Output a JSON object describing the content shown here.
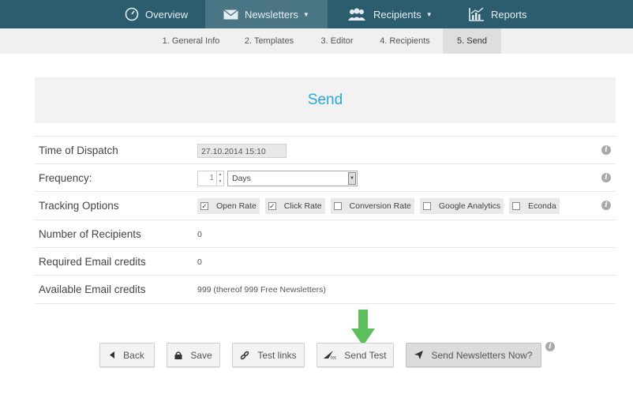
{
  "nav": {
    "overview": "Overview",
    "newsletters": "Newsletters",
    "recipients": "Recipients",
    "reports": "Reports"
  },
  "steps": [
    "1. General Info",
    "2. Templates",
    "3. Editor",
    "4. Recipients",
    "5. Send"
  ],
  "panel": {
    "title": "Send"
  },
  "rows": {
    "dispatch": {
      "label": "Time of Dispatch",
      "value": "27.10.2014 15:10"
    },
    "frequency": {
      "label": "Frequency:",
      "count": "1",
      "unit": "Days"
    },
    "tracking": {
      "label": "Tracking Options",
      "options": [
        {
          "label": "Open Rate",
          "checked": true
        },
        {
          "label": "Click Rate",
          "checked": true
        },
        {
          "label": "Conversion Rate",
          "checked": false
        },
        {
          "label": "Google Analytics",
          "checked": false
        },
        {
          "label": "Econda",
          "checked": false
        }
      ]
    },
    "num_recipients": {
      "label": "Number of Recipients",
      "value": "0"
    },
    "required_credits": {
      "label": "Required Email credits",
      "value": "0"
    },
    "available_credits": {
      "label": "Available Email credits",
      "value": "999 (thereof 999 Free Newsletters)"
    }
  },
  "buttons": {
    "back": "Back",
    "save": "Save",
    "test_links": "Test links",
    "send_test": "Send Test",
    "send_now": "Send Newsletters Now?"
  },
  "colors": {
    "nav_bg": "#2c5d6e",
    "title_accent": "#2aa7d6",
    "arrow": "#5cbf5c"
  }
}
